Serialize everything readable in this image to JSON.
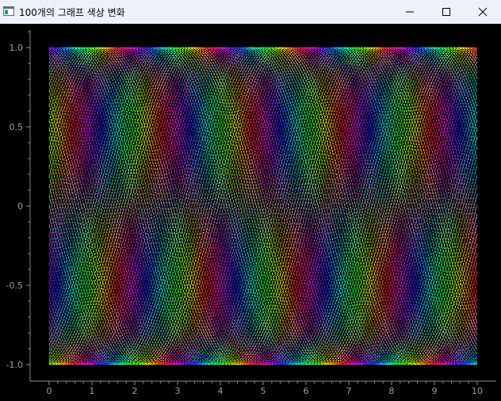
{
  "window": {
    "title": "100개의 그래프 색상 변화",
    "icon": "app-window-icon",
    "buttons": {
      "minimize": "minimize-icon",
      "maximize": "maximize-icon",
      "close": "close-icon"
    }
  },
  "colors": {
    "titlebar_bg": "#eef1f8",
    "plot_bg": "#000000",
    "axis": "#8a8a8a",
    "tick_label": "#a0a0a0"
  },
  "chart_data": {
    "type": "line",
    "title": "",
    "xlabel": "",
    "ylabel": "",
    "xlim": [
      0,
      10
    ],
    "ylim": [
      -1.0,
      1.0
    ],
    "x_ticks": [
      "0",
      "1",
      "2",
      "3",
      "4",
      "5",
      "6",
      "7",
      "8",
      "9",
      "10"
    ],
    "y_ticks": [
      "1.0",
      "0.5",
      "0",
      "-0.5",
      "-1.0"
    ],
    "y_tick_values": [
      1.0,
      0.5,
      0,
      -0.5,
      -1.0
    ],
    "grid": false,
    "legend": "none",
    "series_count": 100,
    "series_function": "y = sin(x + phase), phase evenly spaced",
    "series_palette": [
      "#ff0000",
      "#ffff00",
      "#00ff00",
      "#00ffff",
      "#0000ff",
      "#ff00ff"
    ]
  }
}
